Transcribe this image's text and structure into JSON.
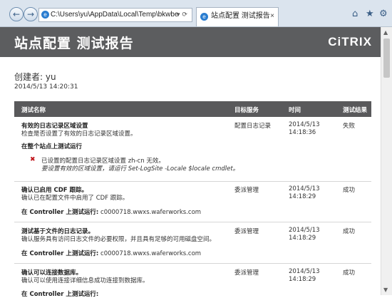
{
  "browser": {
    "address": "C:\\Users\\yu\\AppData\\Local\\Temp\\bkwbe",
    "tab_title": "站点配置 测试报告",
    "tab_close": "×",
    "address_tools": "▾ ⟳"
  },
  "header": {
    "title": "站点配置 测试报告",
    "logo": "CiTRIX"
  },
  "report": {
    "creator": "创建者: yu",
    "date": "2014/5/13 14:20:31"
  },
  "table": {
    "headers": [
      "测试名称",
      "目标服务",
      "时间",
      "测试结果"
    ],
    "rows": [
      {
        "title": "有效的日志记录区域设置",
        "desc": "检查是否设置了有效的日志记录区域设置。",
        "service": "配置日志记录",
        "date": "2014/5/13",
        "time": "14:18:36",
        "result": "失败",
        "section": "在整个站点上测试运行",
        "error": "已设置的配置日志记录区域设置 zh-cn 无效。",
        "hint": "要设置有效的区域设置，请运行 Set-LogSite -Locale $locale cmdlet。"
      },
      {
        "title": "确认已启用 CDF 跟踪。",
        "desc": "确认已在配置文件中启用了 CDF 跟踪。",
        "service": "委派管理",
        "date": "2014/5/13",
        "time": "14:18:29",
        "result": "成功",
        "section_label": "在 Controller 上测试运行:",
        "section_host": "c0000718.wwxs.waferworks.com"
      },
      {
        "title": "测试基于文件的日志记录。",
        "desc": "确认服务具有访问日志文件的必要权限，并且具有足够的可用磁盘空间。",
        "service": "委派管理",
        "date": "2014/5/13",
        "time": "14:18:29",
        "result": "成功",
        "section_label": "在 Controller 上测试运行:",
        "section_host": "c0000718.wwxs.waferworks.com"
      },
      {
        "title": "确认可以连接数据库。",
        "desc": "确认可以使用连接详细信息成功连接到数据库。",
        "service": "委派管理",
        "date": "2014/5/13",
        "time": "14:18:29",
        "result": "成功",
        "section_label": "在 Controller 上测试运行:"
      }
    ]
  },
  "icons": {
    "back": "back-arrow-icon",
    "forward": "forward-arrow-icon",
    "home": "home-icon",
    "favorites": "star-icon",
    "tools": "gear-icon",
    "error": "error-x-icon"
  },
  "colors": {
    "titlebar": "#5c5d5f",
    "error": "#c0141b",
    "accent": "#2a7dd0"
  }
}
